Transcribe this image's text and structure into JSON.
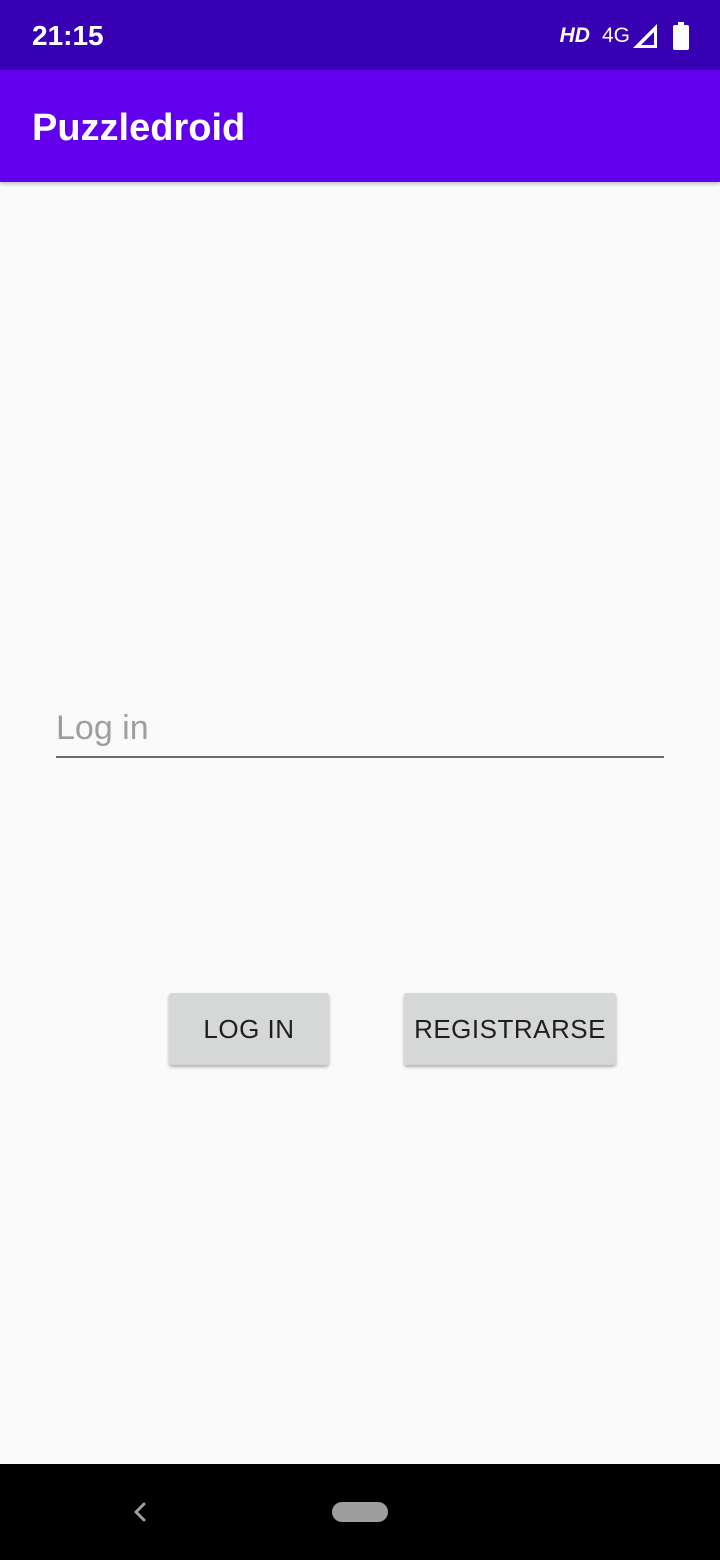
{
  "status_bar": {
    "time": "21:15",
    "hd_label": "HD",
    "network_label": "4G",
    "icons": [
      "signal-icon",
      "battery-icon"
    ]
  },
  "app_bar": {
    "title": "Puzzledroid"
  },
  "form": {
    "login_placeholder": "Log in",
    "login_value": ""
  },
  "buttons": {
    "login_label": "LOG IN",
    "register_label": "REGISTRARSE"
  },
  "nav_bar": {
    "icons": [
      "back-icon",
      "home-pill-icon"
    ]
  },
  "colors": {
    "status_bar": "#3700b3",
    "app_bar": "#6200ee",
    "background": "#fafafa",
    "button": "#d6d7d7"
  }
}
